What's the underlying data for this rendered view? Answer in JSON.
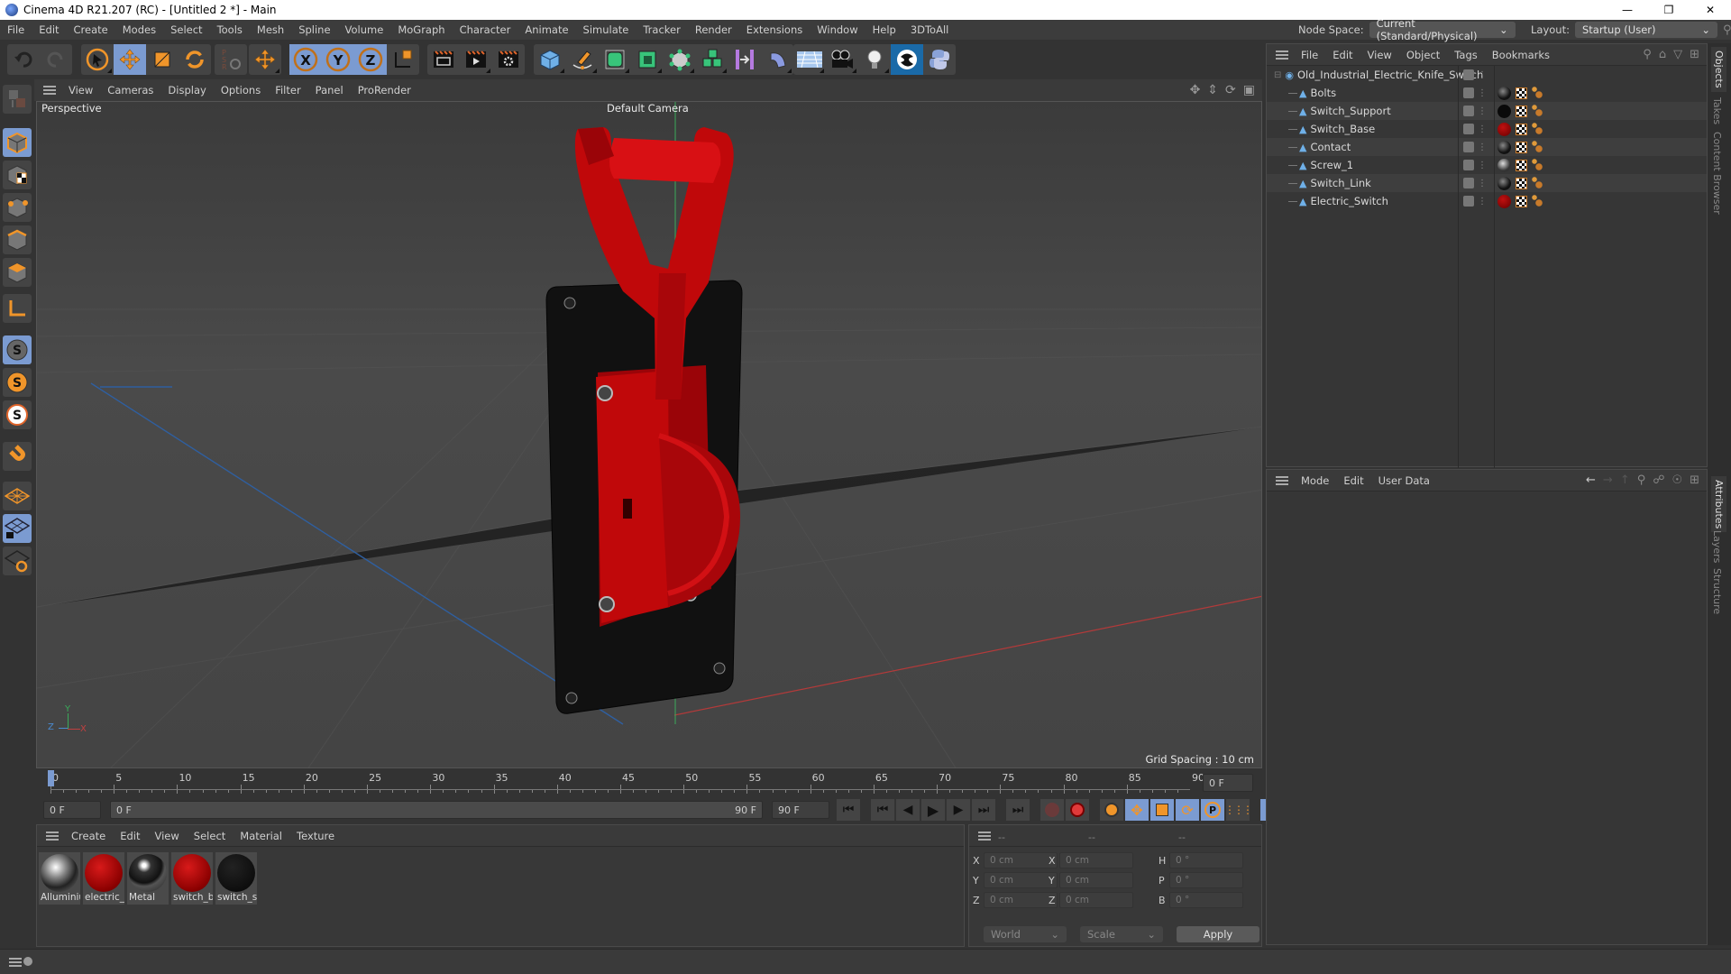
{
  "window": {
    "title": "Cinema 4D R21.207 (RC) - [Untitled 2 *] - Main",
    "controls": [
      "minimize",
      "restore",
      "close"
    ]
  },
  "menubar": {
    "items": [
      "File",
      "Edit",
      "Create",
      "Modes",
      "Select",
      "Tools",
      "Mesh",
      "Spline",
      "Volume",
      "MoGraph",
      "Character",
      "Animate",
      "Simulate",
      "Tracker",
      "Render",
      "Extensions",
      "Window",
      "Help",
      "3DToAll"
    ],
    "node_space_label": "Node Space:",
    "node_space_value": "Current (Standard/Physical)",
    "layout_label": "Layout:",
    "layout_value": "Startup (User)"
  },
  "toolbar": {
    "icons": [
      "undo-icon",
      "redo-icon",
      "live-selection-icon",
      "move-icon",
      "scale-icon",
      "rotate-icon",
      "psr-reset-icon",
      "transform-icon",
      "x-axis-icon",
      "y-axis-icon",
      "z-axis-icon",
      "coordinate-system-icon",
      "render-view-icon",
      "render-picture-viewer-icon",
      "render-settings-icon",
      "cube-icon",
      "pen-icon",
      "subdivision-icon",
      "extrude-icon",
      "polygon-icon",
      "cloner-icon",
      "symmetry-icon",
      "deformer-icon",
      "floor-icon",
      "camera-icon",
      "light-icon",
      "cineware-icon",
      "python-icon"
    ]
  },
  "leftbar": {
    "icons": [
      "make-editable-icon",
      "model-mode-icon",
      "texture-mode-icon",
      "point-mode-icon",
      "edge-mode-icon",
      "polygon-mode-icon",
      "axis-mode-icon",
      "snap-icon",
      "snap-settings-icon",
      "snap-workplane-icon",
      "magnet-icon",
      "workplane-icon",
      "lock-workplane-icon",
      "workplane-rotate-icon"
    ]
  },
  "viewport": {
    "menu": [
      "View",
      "Cameras",
      "Display",
      "Options",
      "Filter",
      "Panel",
      "ProRender"
    ],
    "view_name": "Perspective",
    "camera_name": "Default Camera",
    "grid_spacing": "Grid Spacing : 10 cm",
    "axis_labels": {
      "x": "X",
      "y": "Y",
      "z": "Z"
    }
  },
  "timeline": {
    "ticks": [
      "0",
      "5",
      "10",
      "15",
      "20",
      "25",
      "30",
      "35",
      "40",
      "45",
      "50",
      "55",
      "60",
      "65",
      "70",
      "75",
      "80",
      "85",
      "90"
    ],
    "current_frame": "0 F",
    "start_field": "0 F",
    "range_start": "0 F",
    "range_end": "90 F",
    "end_field": "90 F",
    "playhead_fraction": 0.0
  },
  "materials": {
    "menu": [
      "Create",
      "Edit",
      "View",
      "Select",
      "Material",
      "Texture"
    ],
    "items": [
      {
        "label": "Alluminium",
        "type": "chrome"
      },
      {
        "label": "electric_s",
        "type": "red"
      },
      {
        "label": "Metal",
        "type": "dark-chrome"
      },
      {
        "label": "switch_b",
        "type": "red"
      },
      {
        "label": "switch_s",
        "type": "black"
      }
    ]
  },
  "coordinates": {
    "headers": [
      "--",
      "--",
      "--"
    ],
    "rows": [
      {
        "a_label": "X",
        "a_value": "0 cm",
        "b_label": "X",
        "b_value": "0 cm",
        "c_label": "H",
        "c_value": "0 °"
      },
      {
        "a_label": "Y",
        "a_value": "0 cm",
        "b_label": "Y",
        "b_value": "0 cm",
        "c_label": "P",
        "c_value": "0 °"
      },
      {
        "a_label": "Z",
        "a_value": "0 cm",
        "b_label": "Z",
        "b_value": "0 cm",
        "c_label": "B",
        "c_value": "0 °"
      }
    ],
    "space": "World",
    "mode": "Scale",
    "apply_label": "Apply"
  },
  "objects": {
    "menu": [
      "File",
      "Edit",
      "View",
      "Object",
      "Tags",
      "Bookmarks"
    ],
    "root": "Old_Industrial_Electric_Knife_Switch",
    "children": [
      {
        "name": "Bolts",
        "material": "dark"
      },
      {
        "name": "Switch_Support",
        "material": "black"
      },
      {
        "name": "Switch_Base",
        "material": "red"
      },
      {
        "name": "Contact",
        "material": "dark"
      },
      {
        "name": "Screw_1",
        "material": "chrome"
      },
      {
        "name": "Switch_Link",
        "material": "dark"
      },
      {
        "name": "Electric_Switch",
        "material": "red"
      }
    ]
  },
  "attributes": {
    "menu": [
      "Mode",
      "Edit",
      "User Data"
    ]
  },
  "sidetabs": {
    "top": [
      "Objects",
      "Takes",
      "Content Browser"
    ],
    "bottom": [
      "Attributes",
      "Layers",
      "Structure"
    ]
  },
  "colors": {
    "accent_blue": "#7b9bd1",
    "accent_orange": "#f0952a",
    "model_red": "#c0080a"
  }
}
